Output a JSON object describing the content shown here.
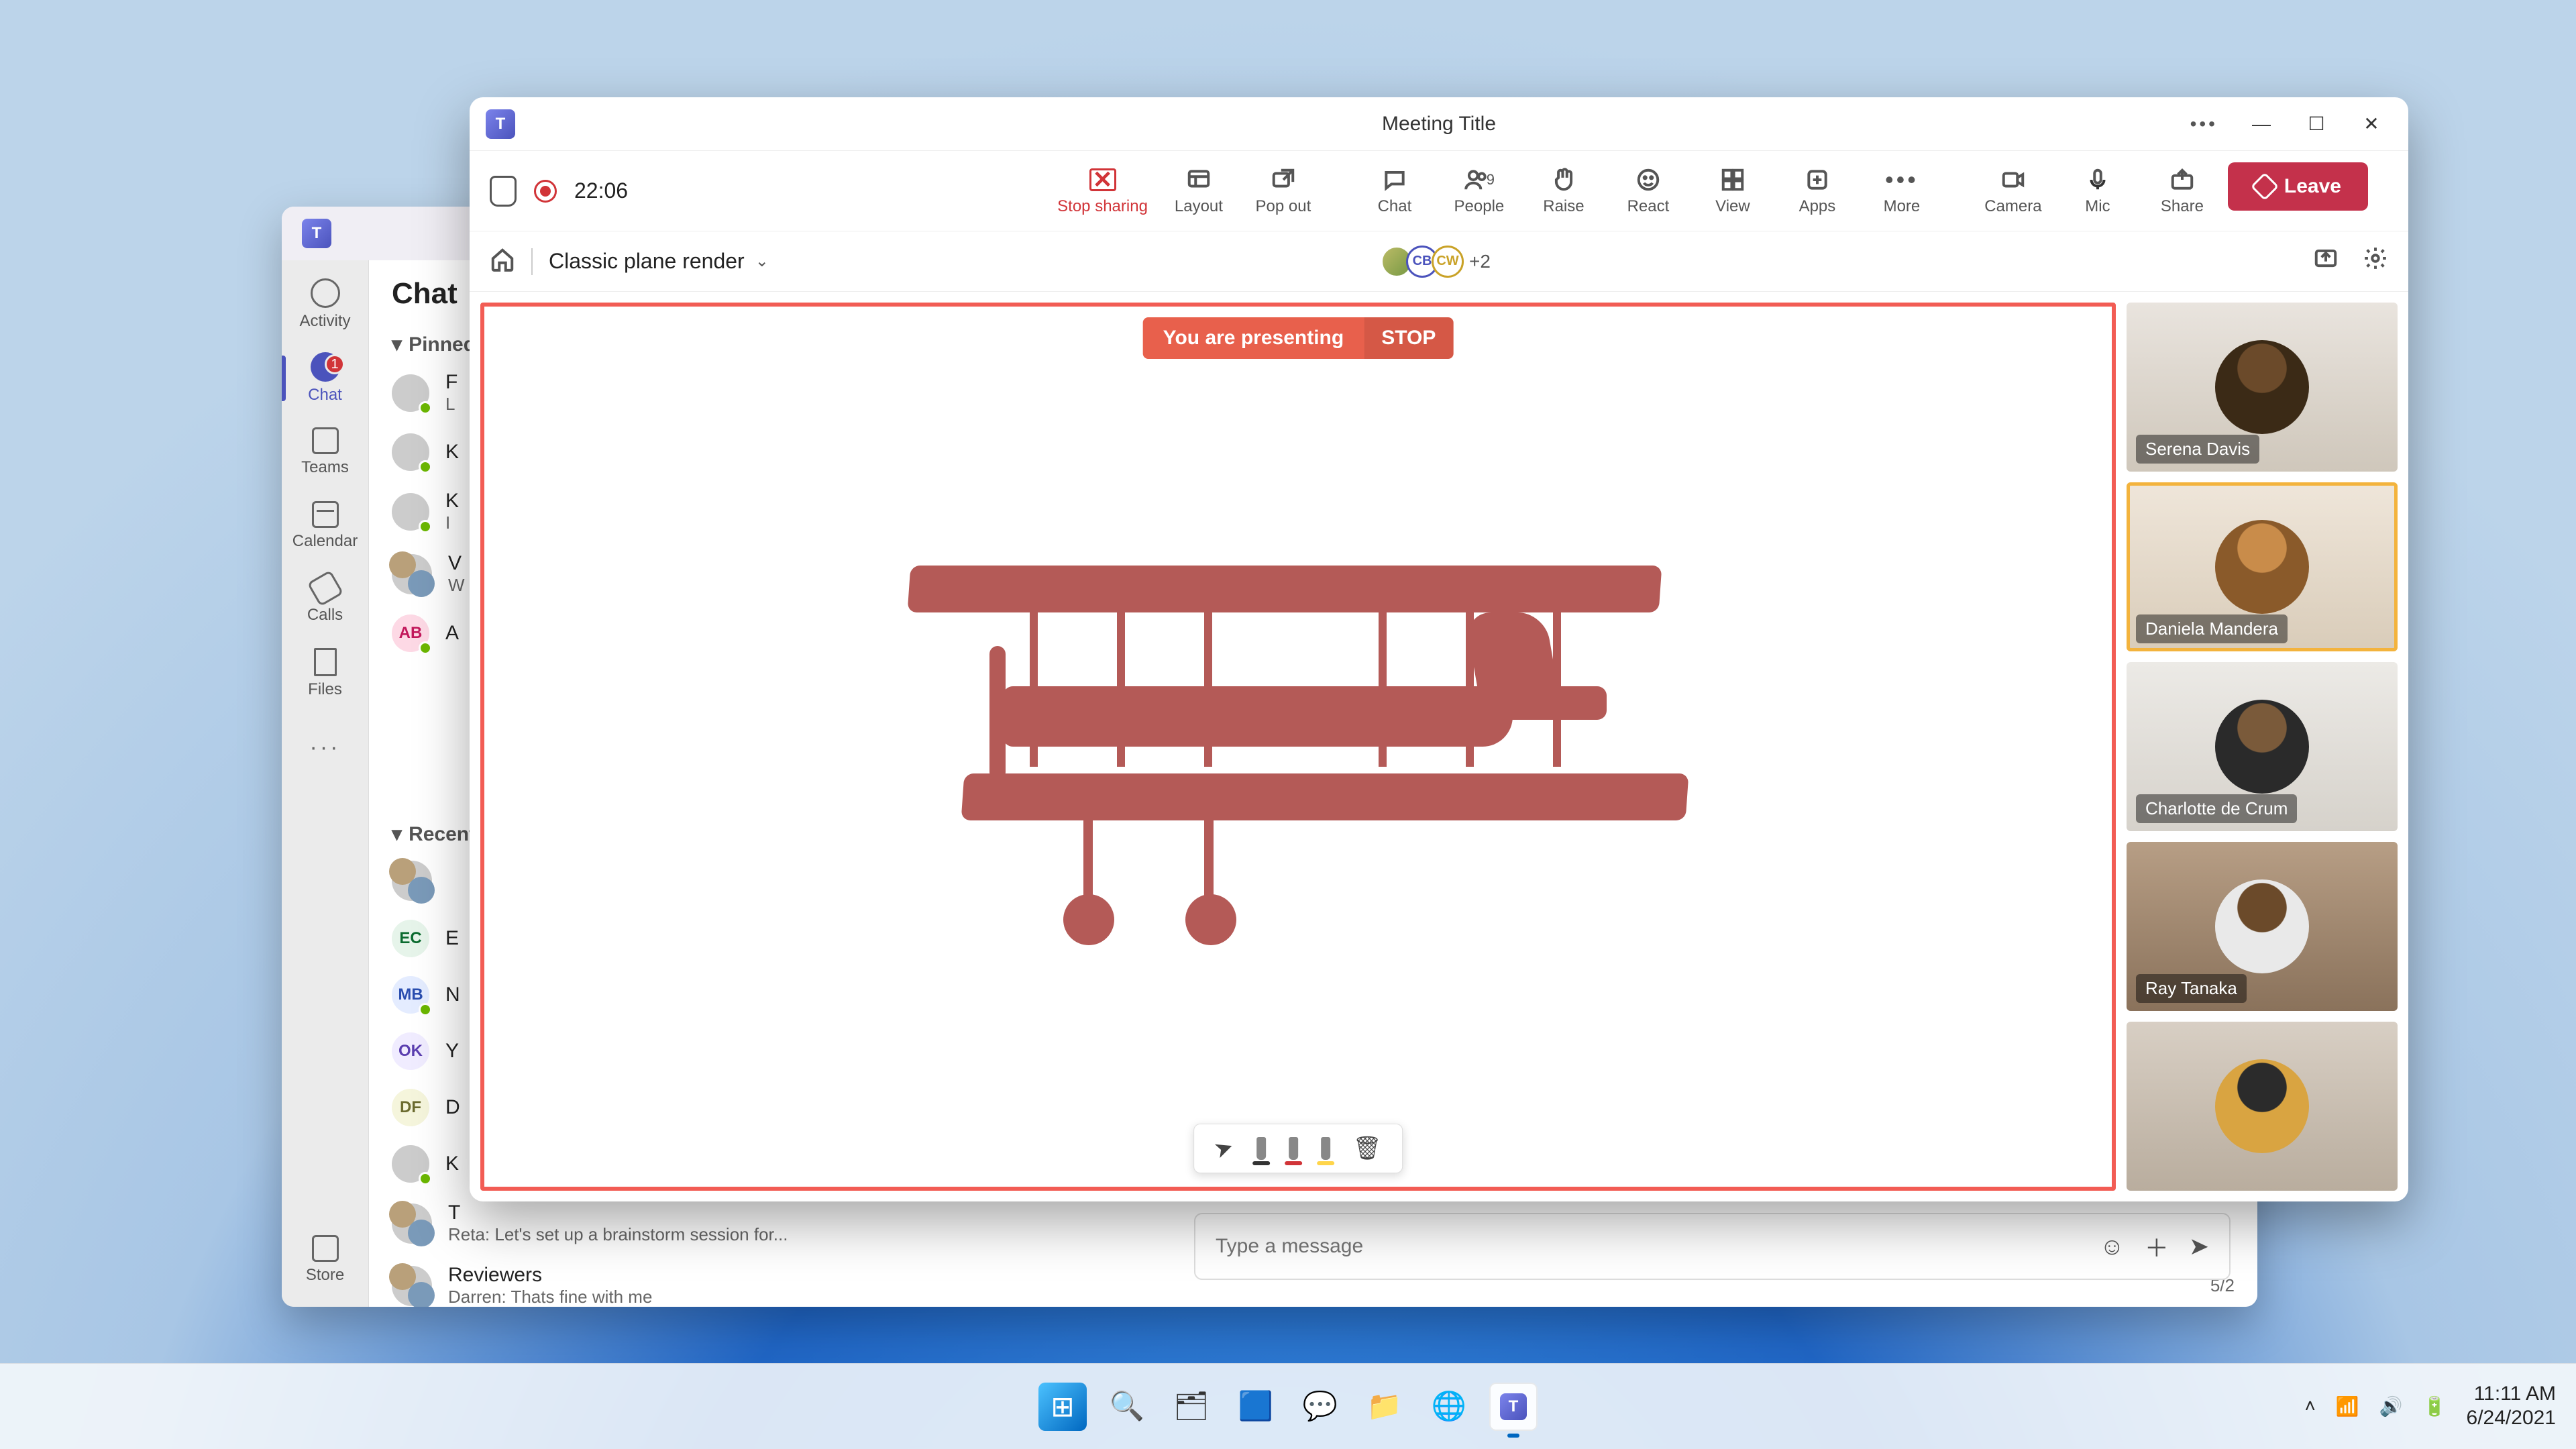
{
  "system": {
    "time": "11:11 AM",
    "date": "6/24/2021"
  },
  "taskbar": {
    "apps": [
      "start",
      "search",
      "task-view",
      "widgets",
      "chat",
      "explorer",
      "edge",
      "teams"
    ]
  },
  "teams_shell": {
    "rail": {
      "activity": "Activity",
      "chat": "Chat",
      "chat_badge": "1",
      "teams": "Teams",
      "calendar": "Calendar",
      "calls": "Calls",
      "files": "Files",
      "store": "Store"
    },
    "chat_panel": {
      "header": "Chat",
      "pinned_label": "Pinned",
      "recent_label": "Recent",
      "pinned": [
        {
          "initials": "",
          "name": "F",
          "preview": "L"
        },
        {
          "initials": "",
          "name": "K",
          "preview": ""
        },
        {
          "initials": "",
          "name": "K",
          "preview": "I"
        },
        {
          "initials": "",
          "name": "V",
          "preview": "W"
        },
        {
          "initials": "AB",
          "name": "A",
          "preview": ""
        }
      ],
      "recent": [
        {
          "initials": "",
          "name": "",
          "preview": ""
        },
        {
          "initials": "EC",
          "name": "E",
          "preview": ""
        },
        {
          "initials": "MB",
          "name": "N",
          "preview": ""
        },
        {
          "initials": "OK",
          "name": "Y",
          "preview": ""
        },
        {
          "initials": "DF",
          "name": "D",
          "preview": ""
        },
        {
          "initials": "",
          "name": "K",
          "preview": ""
        },
        {
          "initials": "",
          "name": "T",
          "preview": "Reta: Let's set up a brainstorm session for..."
        },
        {
          "initials": "",
          "name": "Reviewers",
          "preview": "Darren: Thats fine with me",
          "count": "5/2"
        }
      ]
    },
    "compose_placeholder": "Type a message"
  },
  "meeting": {
    "window_title": "Meeting Title",
    "timer": "22:06",
    "toolbar": {
      "stop_sharing": "Stop sharing",
      "layout": "Layout",
      "popout": "Pop out",
      "chat": "Chat",
      "people": "People",
      "people_count": "9",
      "raise": "Raise",
      "react": "React",
      "view": "View",
      "apps": "Apps",
      "more": "More",
      "camera": "Camera",
      "mic": "Mic",
      "share": "Share",
      "leave": "Leave"
    },
    "context": {
      "doc_title": "Classic plane render",
      "extra_collaborators": "+2"
    },
    "banner": {
      "text": "You are presenting",
      "stop": "STOP"
    },
    "participants": [
      {
        "name": "Serena Davis",
        "speaking": false
      },
      {
        "name": "Daniela Mandera",
        "speaking": true
      },
      {
        "name": "Charlotte de Crum",
        "speaking": false
      },
      {
        "name": "Ray Tanaka",
        "speaking": false
      },
      {
        "name": "",
        "speaking": false
      }
    ]
  }
}
